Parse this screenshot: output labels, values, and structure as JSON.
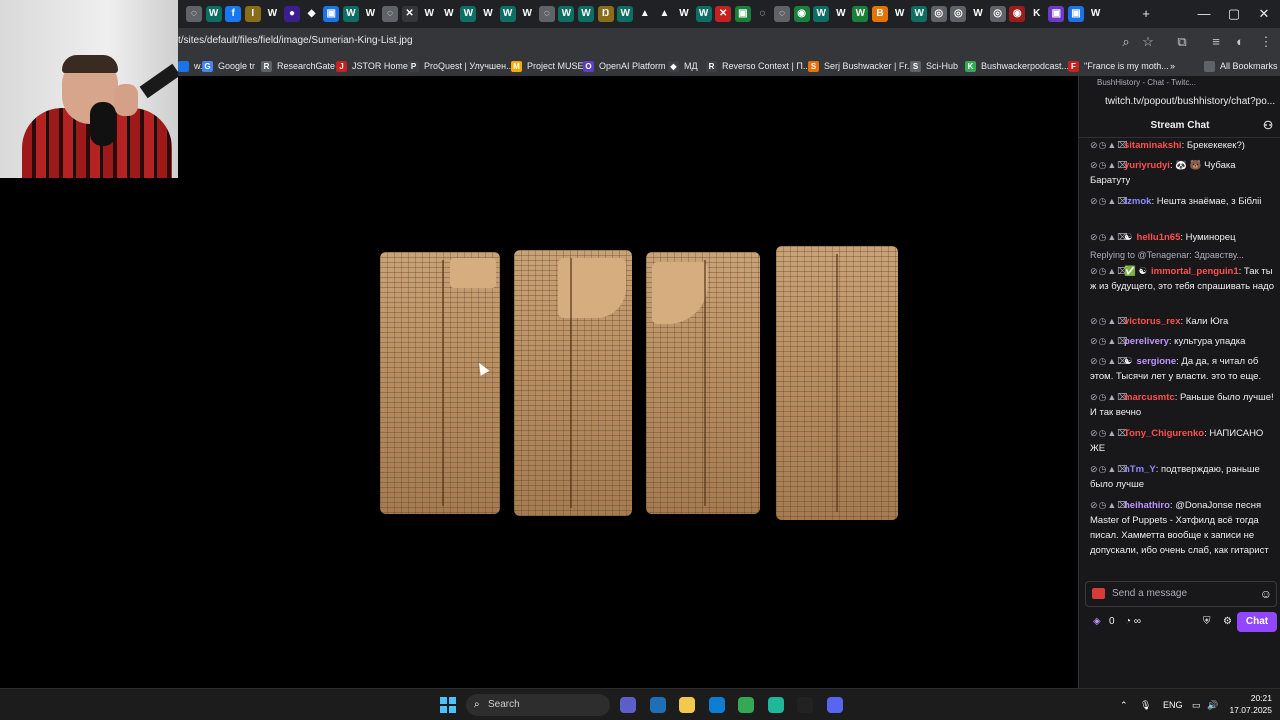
{
  "browser": {
    "url": "t/sites/default/files/field/image/Sumerian-King-List.jpg",
    "tabs": [
      {
        "glyph": "◌",
        "color": "#5f6368"
      },
      {
        "glyph": "W",
        "color": "#0d6e63"
      },
      {
        "glyph": "f",
        "color": "#1877f2"
      },
      {
        "glyph": "I",
        "color": "#8a6d1a"
      },
      {
        "glyph": "W",
        "color": "#202124"
      },
      {
        "glyph": "●",
        "color": "#3b1f8f"
      },
      {
        "glyph": "◆",
        "color": "#202124"
      },
      {
        "glyph": "▣",
        "color": "#1a73e8"
      },
      {
        "glyph": "W",
        "color": "#0d6e63"
      },
      {
        "glyph": "W",
        "color": "#202124"
      },
      {
        "glyph": "◌",
        "color": "#5f6368"
      },
      {
        "glyph": "✕",
        "color": "#35363a"
      },
      {
        "glyph": "W",
        "color": "#202124"
      },
      {
        "glyph": "W",
        "color": "#202124"
      },
      {
        "glyph": "W",
        "color": "#0d6e63"
      },
      {
        "glyph": "W",
        "color": "#202124"
      },
      {
        "glyph": "W",
        "color": "#0d6e63"
      },
      {
        "glyph": "W",
        "color": "#202124"
      },
      {
        "glyph": "◌",
        "color": "#5f6368"
      },
      {
        "glyph": "W",
        "color": "#0d6e63"
      },
      {
        "glyph": "W",
        "color": "#0d6e63"
      },
      {
        "glyph": "Ŋ",
        "color": "#8a6d1a"
      },
      {
        "glyph": "W",
        "color": "#0d6e63"
      },
      {
        "glyph": "▲",
        "color": "#202124"
      },
      {
        "glyph": "▲",
        "color": "#202124"
      },
      {
        "glyph": "W",
        "color": "#202124"
      },
      {
        "glyph": "W",
        "color": "#0d6e63"
      },
      {
        "glyph": "✕",
        "color": "#c5221f"
      },
      {
        "glyph": "▣",
        "color": "#188038"
      },
      {
        "glyph": "◌",
        "color": "#202124"
      },
      {
        "glyph": "◌",
        "color": "#5f6368"
      },
      {
        "glyph": "◉",
        "color": "#188038"
      },
      {
        "glyph": "W",
        "color": "#0d6e63"
      },
      {
        "glyph": "W",
        "color": "#202124"
      },
      {
        "glyph": "W",
        "color": "#188038"
      },
      {
        "glyph": "B",
        "color": "#e37400"
      },
      {
        "glyph": "W",
        "color": "#202124"
      },
      {
        "glyph": "W",
        "color": "#0d6e63"
      },
      {
        "glyph": "◎",
        "color": "#5f6368"
      },
      {
        "glyph": "◎",
        "color": "#5f6368"
      },
      {
        "glyph": "W",
        "color": "#202124"
      },
      {
        "glyph": "◎",
        "color": "#5f6368"
      },
      {
        "glyph": "◉",
        "color": "#9c1b1b"
      },
      {
        "glyph": "K",
        "color": "#202124"
      },
      {
        "glyph": "▣",
        "color": "#6e39c8"
      },
      {
        "glyph": "▣",
        "color": "#1a73e8"
      },
      {
        "glyph": "W",
        "color": "#202124"
      }
    ],
    "new_tab": "+",
    "window_controls": [
      "—",
      "▢",
      "✕"
    ],
    "bookmarks": [
      {
        "label": "w...",
        "icon_color": "#1a73e8",
        "glyph": ""
      },
      {
        "label": "Google tr",
        "icon_color": "#4285f4",
        "glyph": "G"
      },
      {
        "label": "ResearchGate",
        "icon_color": "#5f6368",
        "glyph": "R"
      },
      {
        "label": "JSTOR Home",
        "icon_color": "#c5221f",
        "glyph": "J"
      },
      {
        "label": "ProQuest | Улучшен...",
        "icon_color": "#3c4043",
        "glyph": "P"
      },
      {
        "label": "Project MUSE",
        "icon_color": "#f9ab00",
        "glyph": "M"
      },
      {
        "label": "OpenAI Platform",
        "icon_color": "#5f3dc4",
        "glyph": "O"
      },
      {
        "label": "МД",
        "icon_color": "#3c4043",
        "glyph": "◆"
      },
      {
        "label": "Reverso Context | П...",
        "icon_color": "#3c4043",
        "glyph": "R"
      },
      {
        "label": "Serj Bushwacker | Fr...",
        "icon_color": "#e8710a",
        "glyph": "S"
      },
      {
        "label": "Sci-Hub",
        "icon_color": "#5f6368",
        "glyph": "S"
      },
      {
        "label": "Bushwackerpodcast...",
        "icon_color": "#34a853",
        "glyph": "K"
      },
      {
        "label": "\"France is my moth...",
        "icon_color": "#c5221f",
        "glyph": "F"
      }
    ],
    "all_bookmarks": "All Bookmarks"
  },
  "chat": {
    "window_title": "BushHistory - Chat - Twitc...",
    "popout_url": "twitch.tv/popout/bushhistory/chat?po...",
    "header": "Stream Chat",
    "messages": [
      {
        "user": "sitaminakshi",
        "color": "#ff4f4f",
        "text": ": Брекекекек?)",
        "reply": "",
        "badges": ""
      },
      {
        "user": "yuriyrudyi",
        "color": "#ff4f4f",
        "text": ": 🐼 🐻 Чубака Баратуту",
        "reply": "",
        "badges": ""
      },
      {
        "user": "tzmok",
        "color": "#8f8bff",
        "text": ": Нешта знаёмае, з Бібліі",
        "reply": "",
        "badges": ""
      },
      {
        "user": "hellu1n65",
        "color": "#ff4f4f",
        "text": ": Нуминорец",
        "reply": "",
        "badges": "☯"
      },
      {
        "user": "immortal_penguin1",
        "color": "#ff4f4f",
        "text": ": Так ты ж из будущего, это тебя спрашивать надо",
        "reply": "Replying to @Tenagenar: Здравству...",
        "badges": "✅ ☯"
      },
      {
        "user": "victorus_rex",
        "color": "#ff4f4f",
        "text": ": Кали Юга",
        "reply": "",
        "badges": ""
      },
      {
        "user": "perelivery",
        "color": "#bf94ff",
        "text": ": культура упадка",
        "reply": "",
        "badges": ""
      },
      {
        "user": "sergione",
        "color": "#bf94ff",
        "text": ": Да да, я читал об этом. Тысячи лет у власти. это то еще.",
        "reply": "",
        "badges": "☯"
      },
      {
        "user": "marcusmtc",
        "color": "#ff4f4f",
        "text": ": Раньше было лучше! И так вечно",
        "reply": "",
        "badges": ""
      },
      {
        "user": "Tony_Chigurenko",
        "color": "#ff4f4f",
        "text": ": НАПИСАНО ЖЕ",
        "reply": "",
        "badges": ""
      },
      {
        "user": "nTm_Y",
        "color": "#8f8bff",
        "text": ": подтверждаю, раньше было лучше",
        "reply": "",
        "badges": ""
      },
      {
        "user": "heihathiro",
        "color": "#bf94ff",
        "text": ": @DonaJonse песня Master of Puppets - Хэтфилд всё тогда писал. Хамметта вообще к записи не допускали, ибо очень слаб, как гитарист",
        "reply": "",
        "badges": ""
      }
    ],
    "input_placeholder": "Send a message",
    "points": "0",
    "chat_button": "Chat"
  },
  "taskbar": {
    "search_placeholder": "Search",
    "apps": [
      "#5b5fc7",
      "#1f6fb8",
      "#f2c94c",
      "#0c7ed6",
      "#34a853",
      "#1fb89a",
      "#222222",
      "#5865f2"
    ],
    "tray": {
      "up": "⌃",
      "mic": "🎙",
      "lang": "ENG",
      "monitor": "▭",
      "sound": "🔊"
    },
    "time": "20:21",
    "date": "17.07.2025"
  }
}
